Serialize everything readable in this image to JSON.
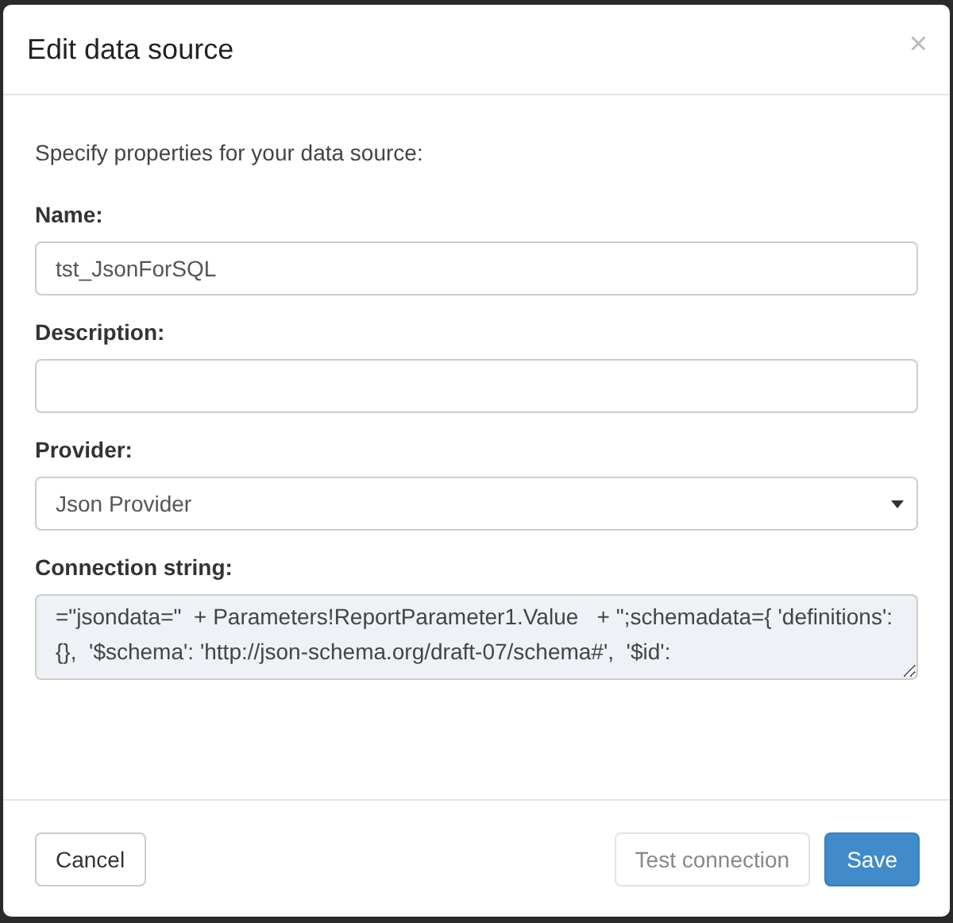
{
  "dialog": {
    "title": "Edit data source",
    "close": "×",
    "intro": "Specify properties for your data source:",
    "fields": [
      {
        "kind": "input",
        "label": "Name:",
        "value": "tst_JsonForSQL"
      },
      {
        "kind": "input",
        "label": "Description:"
      },
      {
        "kind": "select",
        "label": "Provider:",
        "value": "Json Provider"
      },
      {
        "kind": "textarea",
        "label": "Connection string:",
        "value": "=\"jsondata=\"  + Parameters!ReportParameter1.Value   + \";schemadata={ 'definitions': {},  '$schema': 'http://json-schema.org/draft-07/schema#',  '$id':"
      }
    ],
    "buttons": [
      {
        "label": "Cancel",
        "kind": "default",
        "disabled": false
      },
      {
        "label": "Test connection",
        "kind": "default",
        "disabled": true
      },
      {
        "label": "Save",
        "kind": "primary",
        "disabled": false
      }
    ]
  }
}
